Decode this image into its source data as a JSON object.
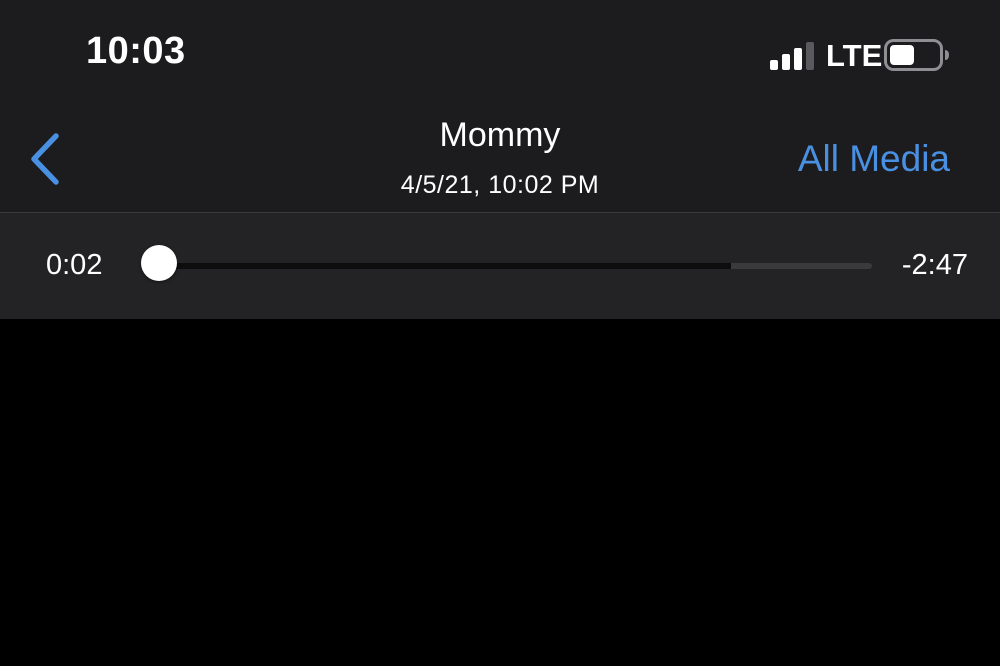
{
  "status_bar": {
    "time": "10:03",
    "network": "LTE",
    "signal_bars": 3,
    "signal_bars_total": 4,
    "battery_level": 0.5
  },
  "nav": {
    "back_icon": "chevron-left-icon",
    "title": "Mommy",
    "subtitle": "4/5/21, 10:02 PM",
    "all_media_label": "All Media"
  },
  "player": {
    "elapsed": "0:02",
    "remaining": "-2:47",
    "progress": 0.012,
    "buffered": 0.805
  },
  "colors": {
    "accent": "#4a90e2",
    "header_bg": "#1c1c1e",
    "player_bg": "#232325",
    "content_bg": "#000000"
  }
}
